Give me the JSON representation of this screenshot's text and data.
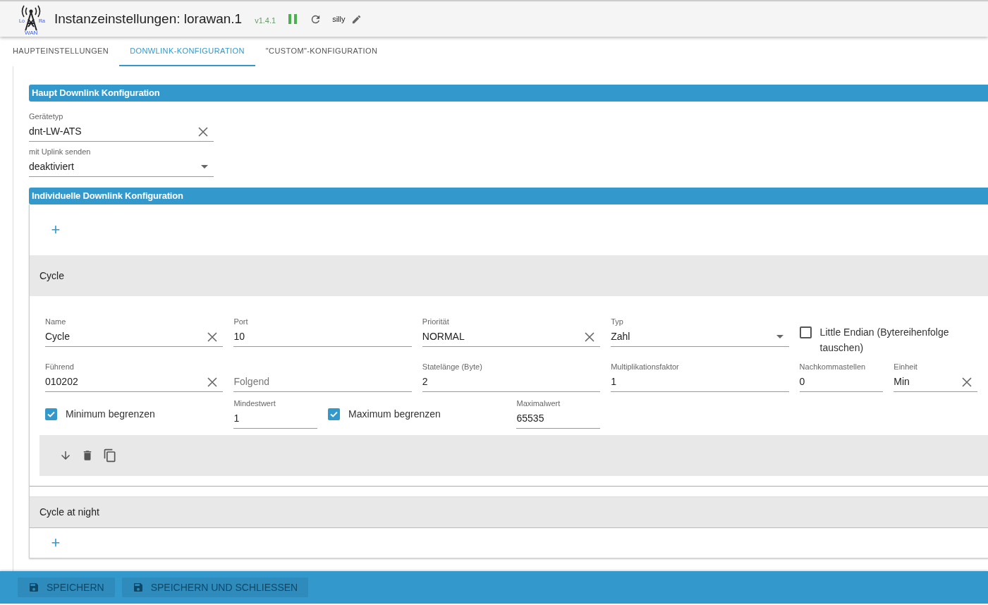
{
  "header": {
    "logo": {
      "left": "Lo",
      "right": "Ra",
      "bottom": "WAN"
    },
    "title": "Instanzeinstellungen: lorawan.1",
    "version": "v1.4.1",
    "log_level": "silly"
  },
  "tabs": [
    {
      "label": "HAUPTEINSTELLUNGEN",
      "selected": false
    },
    {
      "label": "DONWLINK-KONFIGURATION",
      "selected": true
    },
    {
      "label": "\"CUSTOM\"-KONFIGURATION",
      "selected": false
    }
  ],
  "main_section": {
    "title": "Haupt Downlink Konfiguration",
    "fields": [
      {
        "kind": "text",
        "label": "Gerätetyp",
        "value": "dnt-LW-ATS",
        "clearable": true
      },
      {
        "kind": "select",
        "label": "mit Uplink senden",
        "value": "deaktiviert"
      }
    ]
  },
  "individual_section": {
    "title": "Individuelle Downlink Konfiguration",
    "add_label": "+",
    "items": [
      {
        "name": "Cycle",
        "expanded": true,
        "rows": [
          [
            {
              "kind": "text",
              "label": "Name",
              "value": "Cycle",
              "clearable": true
            },
            {
              "kind": "text",
              "label": "Port",
              "value": "10",
              "clearable": false
            },
            {
              "kind": "text",
              "label": "Priorität",
              "value": "NORMAL",
              "clearable": true
            },
            {
              "kind": "select",
              "label": "Typ",
              "value": "Zahl"
            },
            {
              "kind": "checkbox",
              "label": "Little Endian (Bytereihenfolge tauschen)",
              "checked": false
            }
          ],
          [
            {
              "kind": "text",
              "label": "Führend",
              "value": "010202",
              "clearable": true
            },
            {
              "kind": "text",
              "placeholder": "Folgend",
              "clearable": false
            },
            {
              "kind": "text",
              "label": "Statelänge (Byte)",
              "value": "2",
              "clearable": false
            },
            {
              "kind": "text",
              "label": "Multiplikationsfaktor",
              "value": "1",
              "clearable": false
            },
            {
              "kind": "text",
              "label": "Nachkommastellen",
              "value": "0",
              "clearable": false
            },
            {
              "kind": "text",
              "label": "Einheit",
              "value": "Min",
              "clearable": true
            }
          ],
          [
            {
              "kind": "checkbox",
              "label": "Minimum begrenzen",
              "checked": true
            },
            {
              "kind": "text",
              "label": "Mindestwert",
              "value": "1",
              "clearable": false
            },
            {
              "kind": "checkbox",
              "label": "Maximum begrenzen",
              "checked": true
            },
            {
              "kind": "text",
              "label": "Maximalwert",
              "value": "65535",
              "clearable": false
            }
          ]
        ]
      },
      {
        "name": "Cycle at night",
        "expanded": false,
        "add_label": "+"
      }
    ]
  },
  "footer": {
    "buttons": [
      {
        "label": "SPEICHERN",
        "disabled": true
      },
      {
        "label": "SPEICHERN UND SCHLIESSEN",
        "disabled": true
      }
    ]
  }
}
